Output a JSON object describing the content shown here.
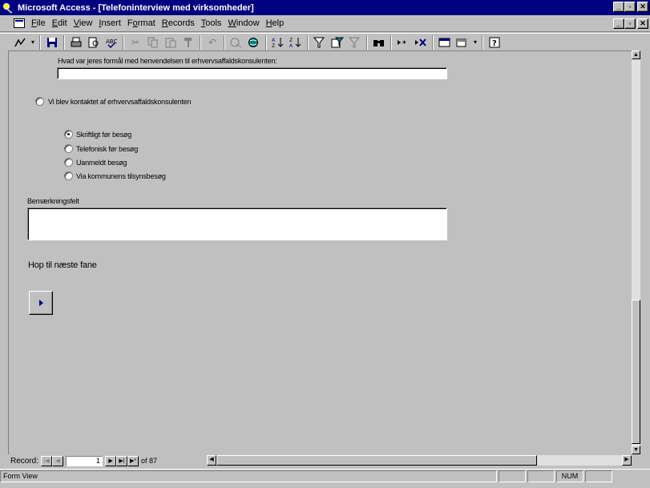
{
  "window": {
    "title": "Microsoft Access - [Telefoninterview med virksomheder]",
    "caption_buttons": [
      "_",
      "▫",
      "✕"
    ],
    "mdi_buttons": [
      "_",
      "▫",
      "✕"
    ]
  },
  "menu": {
    "items": [
      {
        "label": "File",
        "accel": "F"
      },
      {
        "label": "Edit",
        "accel": "E"
      },
      {
        "label": "View",
        "accel": "V"
      },
      {
        "label": "Insert",
        "accel": "I"
      },
      {
        "label": "Format",
        "accel": "o"
      },
      {
        "label": "Records",
        "accel": "R"
      },
      {
        "label": "Tools",
        "accel": "T"
      },
      {
        "label": "Window",
        "accel": "W"
      },
      {
        "label": "Help",
        "accel": "H"
      }
    ]
  },
  "toolbar": {
    "icons": [
      "view-icon",
      "save-icon",
      "print-icon",
      "print-preview-icon",
      "spelling-icon",
      "cut-icon",
      "copy-icon",
      "paste-icon",
      "format-painter-icon",
      "undo-icon",
      "insert-hyperlink-icon",
      "web-toolbar-icon",
      "sort-ascending-icon",
      "sort-descending-icon",
      "filter-by-selection-icon",
      "filter-by-form-icon",
      "apply-filter-icon",
      "find-icon",
      "new-record-icon",
      "delete-record-icon",
      "database-window-icon",
      "new-object-icon",
      "help-icon"
    ]
  },
  "form": {
    "question_label": "Hvad var jeres formål med henvendelsen til erhvervsaffaldskonsulenten:",
    "question_value": "",
    "contacted_label": "Vi blev kontaktet af erhvervsaffaldskonsulenten",
    "options": [
      {
        "label": "Skriftligt før besøg",
        "checked": true
      },
      {
        "label": "Telefonisk før besøg",
        "checked": false
      },
      {
        "label": "Uanmeldt besøg",
        "checked": false
      },
      {
        "label": "Via kommunens tilsynsbesøg",
        "checked": false
      }
    ],
    "remarks_label": "Bemærkningsfelt",
    "remarks_value": "",
    "next_tab_label": "Hop til næste fane"
  },
  "navigator": {
    "label": "Record:",
    "current": "1",
    "of_text": "of  87"
  },
  "status": {
    "text": "Form View",
    "num_indicator": "NUM"
  },
  "colors": {
    "titlebar": "#000080",
    "face": "#c0c0c0"
  }
}
